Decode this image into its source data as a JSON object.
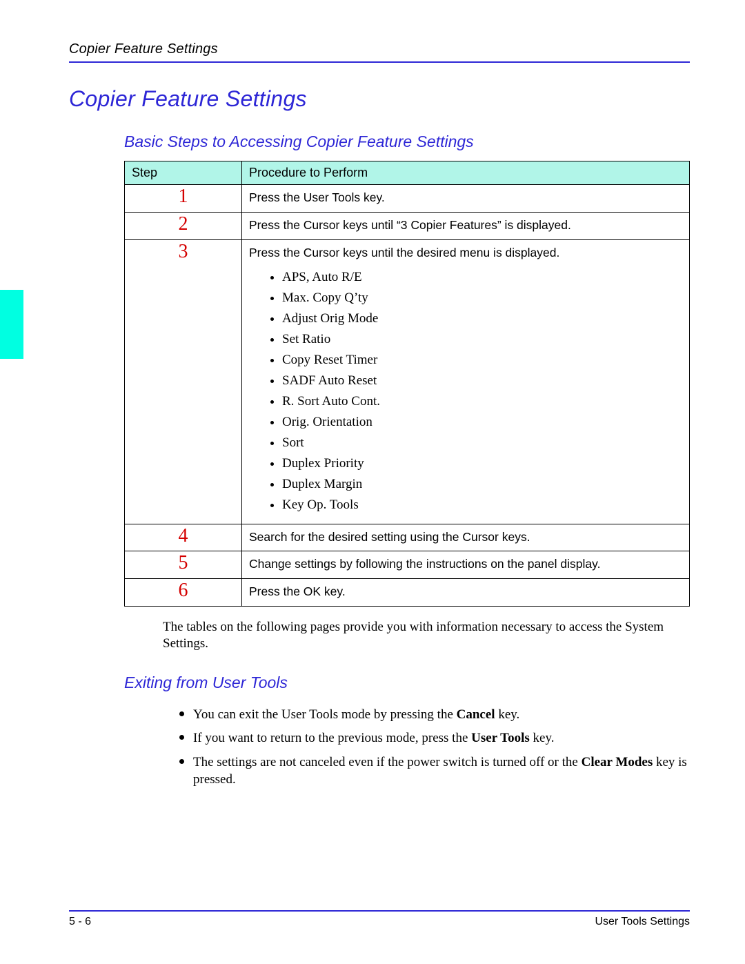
{
  "header": {
    "running_title": "Copier Feature Settings"
  },
  "title": "Copier Feature Settings",
  "section1": {
    "heading": "Basic Steps to Accessing Copier Feature Settings",
    "table": {
      "col_step": "Step",
      "col_proc": "Procedure to Perform",
      "rows": [
        {
          "n": "1",
          "text": "Press the User Tools key."
        },
        {
          "n": "2",
          "text": "Press the Cursor keys until “3 Copier Features” is displayed."
        },
        {
          "n": "3",
          "text": "Press the Cursor keys until the desired menu is displayed.",
          "items": [
            "APS, Auto R/E",
            "Max. Copy Q’ty",
            "Adjust Orig Mode",
            "Set Ratio",
            "Copy Reset Timer",
            "SADF Auto Reset",
            "R. Sort Auto Cont.",
            "Orig. Orientation",
            "Sort",
            "Duplex Priority",
            "Duplex Margin",
            "Key Op. Tools"
          ]
        },
        {
          "n": "4",
          "text": "Search for the desired setting using the Cursor keys."
        },
        {
          "n": "5",
          "text": "Change settings by following the instructions on the panel display."
        },
        {
          "n": "6",
          "text": "Press the OK key."
        }
      ]
    },
    "after_para": "The tables on the following pages provide you with information necessary to access the System Settings."
  },
  "section2": {
    "heading": "Exiting from User Tools",
    "bullets": {
      "b1_pre": "You can exit the User Tools mode by pressing the ",
      "b1_bold": "Cancel",
      "b1_post": " key.",
      "b2_pre": "If you want to return to the previous mode, press the ",
      "b2_bold": "User Tools",
      "b2_post": " key.",
      "b3_pre": "The settings are not canceled even if the power switch is turned off or the ",
      "b3_bold": "Clear Modes",
      "b3_post": " key is pressed."
    }
  },
  "footer": {
    "left": "5 - 6",
    "right": "User Tools Settings"
  }
}
